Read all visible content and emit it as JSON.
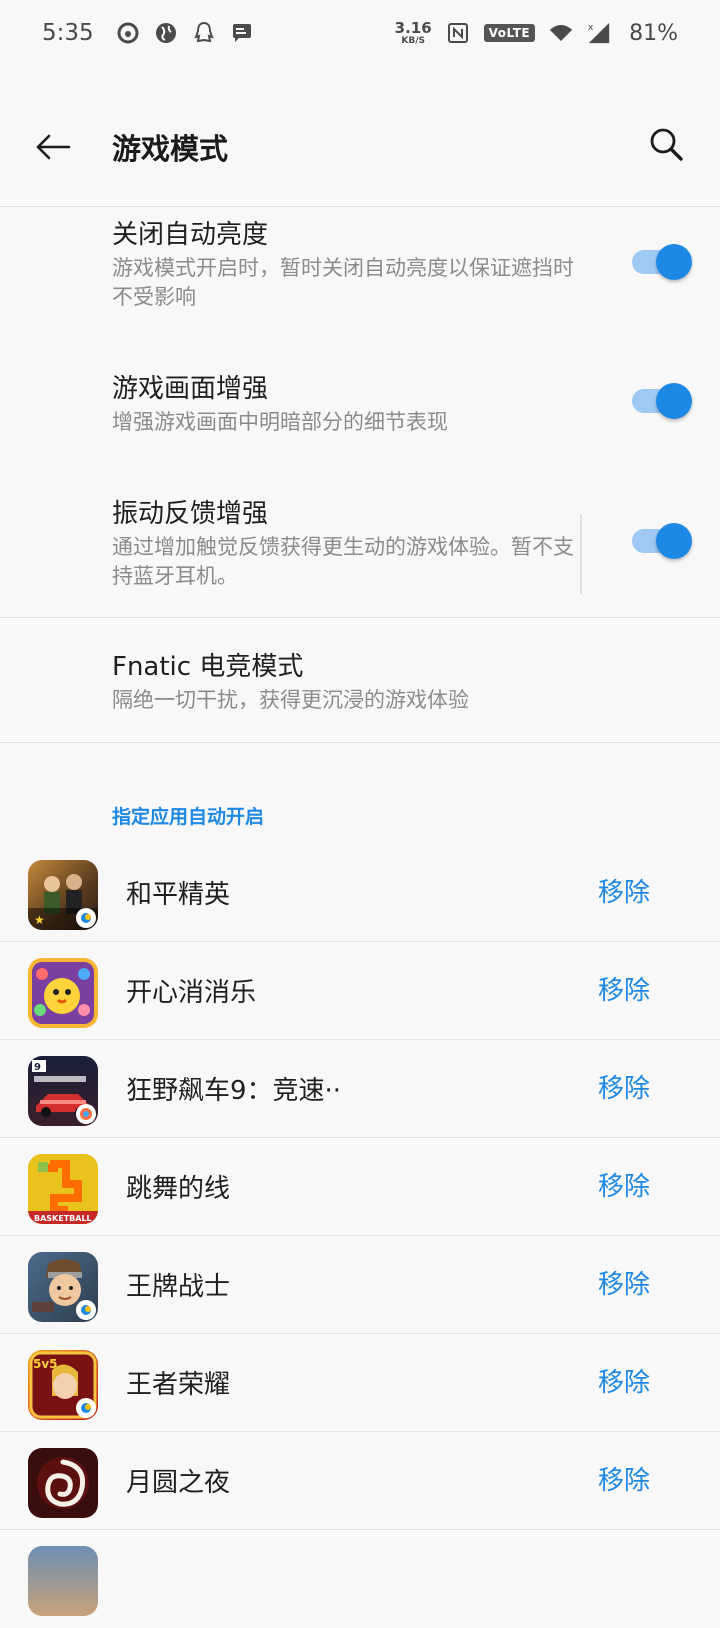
{
  "status_bar": {
    "time": "5:35",
    "net_speed_value": "3.16",
    "net_speed_unit": "KB/S",
    "volte": "VoLTE",
    "battery": "81%"
  },
  "header": {
    "title": "游戏模式"
  },
  "settings": [
    {
      "title": "关闭自动亮度",
      "desc": "游戏模式开启时，暂时关闭自动亮度以保证遮挡时不受影响",
      "toggle_on": true
    },
    {
      "title": "游戏画面增强",
      "desc": "增强游戏画面中明暗部分的细节表现",
      "toggle_on": true
    },
    {
      "title": "振动反馈增强",
      "desc": "通过增加触觉反馈获得更生动的游戏体验。暂不支持蓝牙耳机。",
      "toggle_on": true
    },
    {
      "title": "Fnatic 电竞模式",
      "desc": "隔绝一切干扰，获得更沉浸的游戏体验"
    }
  ],
  "section": {
    "title": "指定应用自动开启"
  },
  "apps": [
    {
      "name": "和平精英",
      "action": "移除",
      "icon": "pubg-app-icon"
    },
    {
      "name": "开心消消乐",
      "action": "移除",
      "icon": "happy-match-app-icon"
    },
    {
      "name": "狂野飙车9：竞速··",
      "action": "移除",
      "icon": "asphalt-app-icon"
    },
    {
      "name": "跳舞的线",
      "action": "移除",
      "icon": "dancing-line-app-icon"
    },
    {
      "name": "王牌战士",
      "action": "移除",
      "icon": "ace-soldier-app-icon"
    },
    {
      "name": "王者荣耀",
      "action": "移除",
      "icon": "honor-of-kings-app-icon"
    },
    {
      "name": "月圆之夜",
      "action": "移除",
      "icon": "full-moon-night-app-icon"
    }
  ],
  "colors": {
    "accent": "#1e88e5",
    "toggle_track": "#9ec9f3",
    "background": "#f8f8f8"
  }
}
